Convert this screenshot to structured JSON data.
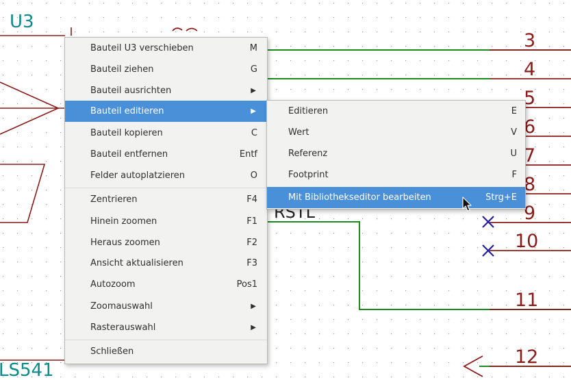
{
  "schematic": {
    "ref_label": "U3",
    "value_label": "LS541",
    "pin_numbers": [
      "3",
      "4",
      "5",
      "6",
      "7",
      "8",
      "9",
      "10",
      "11",
      "12"
    ],
    "partial_pin_text": "RSTL",
    "colors": {
      "wire": "#1a8a1a",
      "pin": "#8b1a1a",
      "label": "#0a8a8a",
      "noconnect": "#2020a0",
      "grid": "#9a9a9a"
    }
  },
  "context_menu": {
    "items": [
      {
        "label": "Bauteil U3 verschieben",
        "shortcut": "M"
      },
      {
        "label": "Bauteil ziehen",
        "shortcut": "G"
      },
      {
        "label": "Bauteil ausrichten",
        "submenu": true
      },
      {
        "label": "Bauteil editieren",
        "submenu": true,
        "highlighted": true
      },
      {
        "label": "Bauteil kopieren",
        "shortcut": "C"
      },
      {
        "label": "Bauteil entfernen",
        "shortcut": "Entf"
      },
      {
        "label": "Felder autoplatzieren",
        "shortcut": "O"
      },
      {
        "label": "Zentrieren",
        "shortcut": "F4"
      },
      {
        "label": "Hinein zoomen",
        "shortcut": "F1"
      },
      {
        "label": "Heraus zoomen",
        "shortcut": "F2"
      },
      {
        "label": "Ansicht aktualisieren",
        "shortcut": "F3"
      },
      {
        "label": "Autozoom",
        "shortcut": "Pos1"
      },
      {
        "label": "Zoomauswahl",
        "submenu": true
      },
      {
        "label": "Rasterauswahl",
        "submenu": true
      },
      {
        "label": "Schließen"
      }
    ],
    "submenu_arrow": "▶"
  },
  "sub_menu": {
    "items": [
      {
        "label": "Editieren",
        "shortcut": "E"
      },
      {
        "label": "Wert",
        "shortcut": "V"
      },
      {
        "label": "Referenz",
        "shortcut": "U"
      },
      {
        "label": "Footprint",
        "shortcut": "F"
      },
      {
        "label": "Mit Bibliothekseditor bearbeiten",
        "shortcut": "Strg+E",
        "highlighted": true
      }
    ]
  }
}
